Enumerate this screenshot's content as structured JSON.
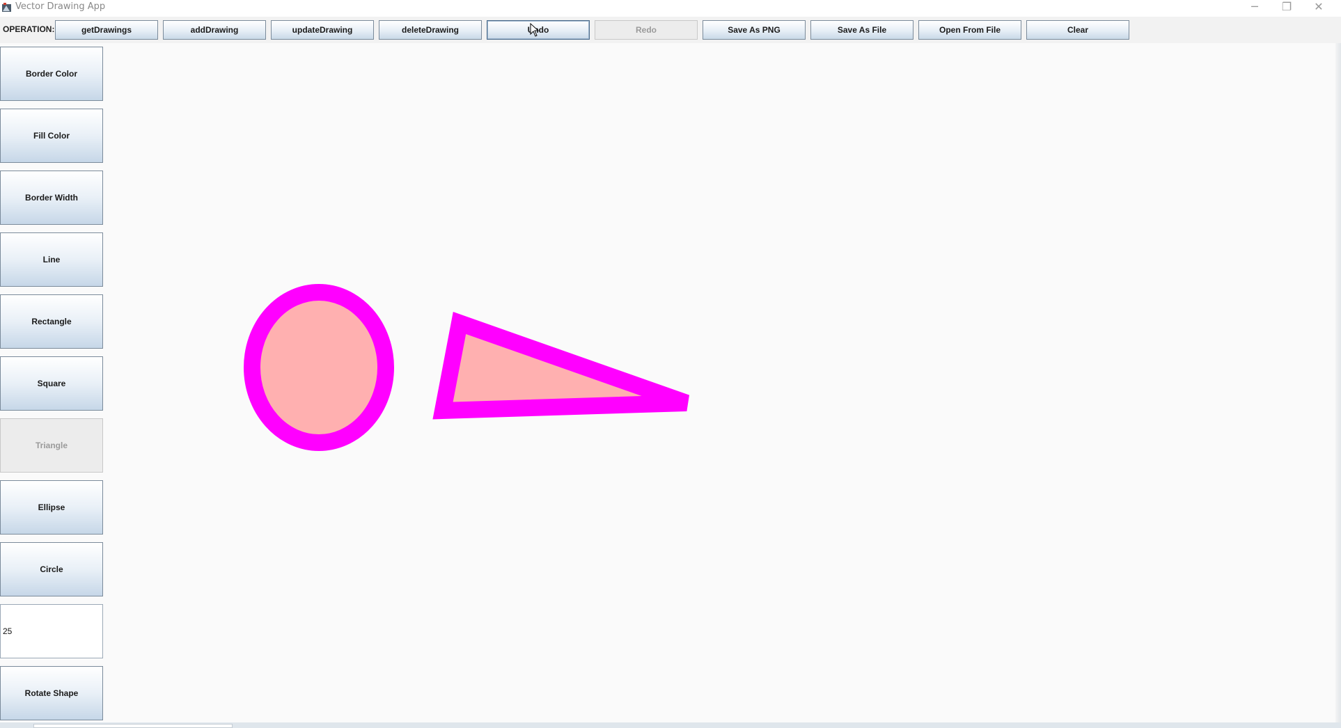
{
  "window": {
    "title": "Vector Drawing App",
    "controls": {
      "minimize": "─",
      "restore": "❐",
      "close": "✕"
    },
    "icon": "app-icon"
  },
  "toolbar": {
    "operation_label": "OPERATION:",
    "buttons": [
      {
        "label": "getDrawings",
        "state": "enabled"
      },
      {
        "label": "addDrawing",
        "state": "enabled"
      },
      {
        "label": "updateDrawing",
        "state": "enabled"
      },
      {
        "label": "deleteDrawing",
        "state": "enabled"
      },
      {
        "label": "Undo",
        "state": "focused"
      },
      {
        "label": "Redo",
        "state": "disabled"
      },
      {
        "label": "Save As PNG",
        "state": "enabled"
      },
      {
        "label": "Save As File",
        "state": "enabled"
      },
      {
        "label": "Open From File",
        "state": "enabled"
      },
      {
        "label": "Clear",
        "state": "enabled"
      }
    ]
  },
  "sidebar": {
    "buttons": [
      {
        "label": "Border Color",
        "state": "enabled"
      },
      {
        "label": "Fill Color",
        "state": "enabled"
      },
      {
        "label": "Border Width",
        "state": "enabled"
      },
      {
        "label": "Line",
        "state": "enabled"
      },
      {
        "label": "Rectangle",
        "state": "enabled"
      },
      {
        "label": "Square",
        "state": "enabled"
      },
      {
        "label": "Triangle",
        "state": "disabled"
      },
      {
        "label": "Ellipse",
        "state": "enabled"
      },
      {
        "label": "Circle",
        "state": "enabled"
      }
    ],
    "rotation_value": "25",
    "rotate_button": "Rotate Shape"
  },
  "canvas": {
    "shapes": [
      {
        "type": "ellipse",
        "border_color": "#ff00ff",
        "fill_color": "#ffb0b0"
      },
      {
        "type": "triangle",
        "border_color": "#ff00ff",
        "fill_color": "#ffb0b0"
      }
    ]
  },
  "colors": {
    "button_border": "#7a8a9a",
    "disabled_text": "#9a9a9a",
    "shape_border": "#ff00ff",
    "shape_fill": "#ffb0b0"
  }
}
